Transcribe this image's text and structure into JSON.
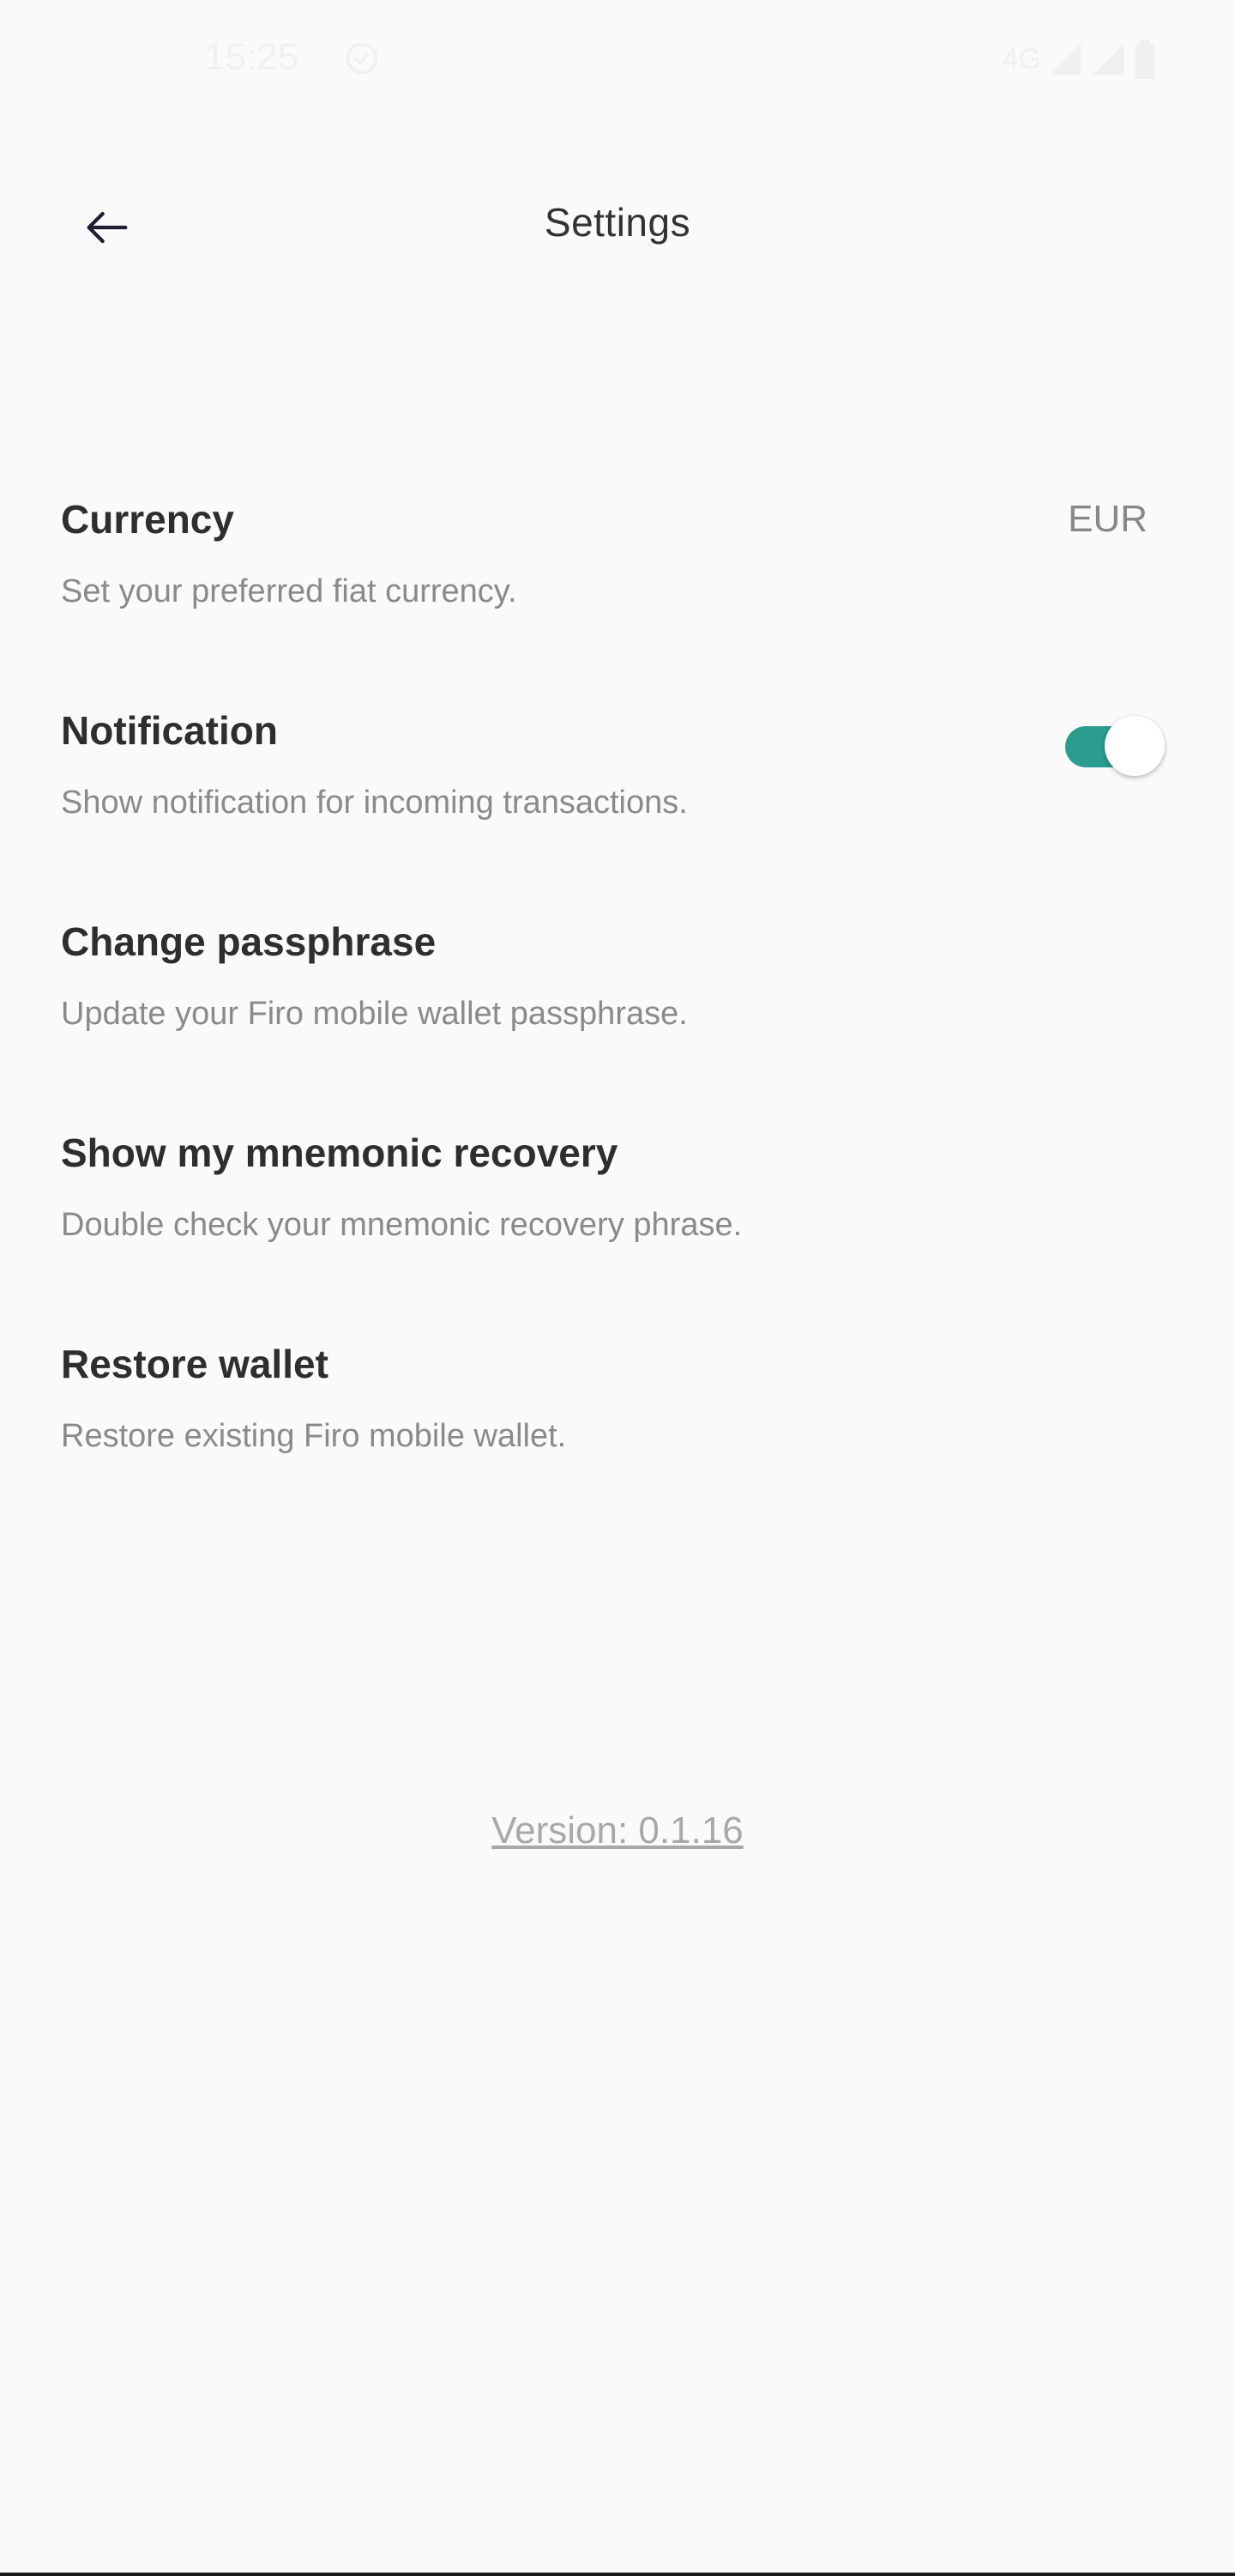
{
  "status_bar": {
    "time": "15:25",
    "network": "4G"
  },
  "header": {
    "title": "Settings"
  },
  "settings": {
    "currency": {
      "title": "Currency",
      "subtitle": "Set your preferred fiat currency.",
      "value": "EUR"
    },
    "notification": {
      "title": "Notification",
      "subtitle": "Show notification for incoming transactions.",
      "enabled": true
    },
    "change_passphrase": {
      "title": "Change passphrase",
      "subtitle": "Update your Firo mobile wallet passphrase."
    },
    "mnemonic": {
      "title": "Show my mnemonic recovery",
      "subtitle": "Double check your mnemonic recovery phrase."
    },
    "restore": {
      "title": "Restore wallet",
      "subtitle": "Restore existing Firo mobile wallet."
    }
  },
  "footer": {
    "version": "Version: 0.1.16"
  },
  "colors": {
    "background": "#fafafa",
    "accent": "#2a9d8f",
    "title_text": "#2e2e2e",
    "subtitle_text": "#8a8a8a"
  }
}
